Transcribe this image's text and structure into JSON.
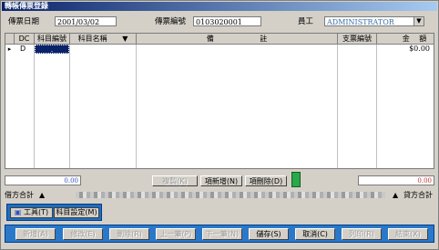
{
  "window": {
    "title": "轉帳傳票登錄"
  },
  "header": {
    "date_label": "傳票日期",
    "date_value": "2001/03/02",
    "voucher_label": "傳票編號",
    "voucher_value": "0103020001",
    "staff_label": "員工",
    "staff_value": "ADMINISTRATOR"
  },
  "grid": {
    "columns": [
      "DC",
      "科目編號",
      "科目名稱",
      "備",
      "註",
      "支票編號",
      "金",
      "額"
    ],
    "row": {
      "indicator": "▸",
      "dc": "D",
      "account_no": ".",
      "amount": "$0.00"
    }
  },
  "totals": {
    "debit": "0.00",
    "credit": "0.00"
  },
  "grid_buttons": {
    "copy": "複製(K)",
    "insert": "項新增(N)",
    "delete": "項刪除(D)"
  },
  "balance_bar": {
    "debit_label": "借方合計",
    "credit_label": "貸方合計"
  },
  "mid_buttons": {
    "tools": "工具(T)",
    "account_setup": "科目設定(M)"
  },
  "bottom_buttons": [
    "新增(A)",
    "修改(E)",
    "刪除(R)",
    "上一筆(P)",
    "下一筆(N)",
    "儲存(S)",
    "取消(C)",
    "列印(R)",
    "結束(X)"
  ]
}
